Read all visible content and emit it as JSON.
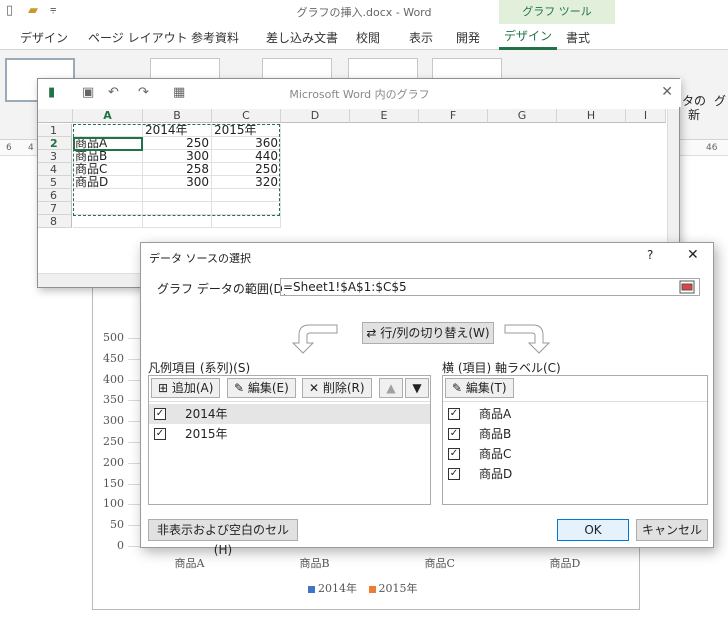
{
  "word": {
    "doc_title": "グラフの挿入.docx - Word",
    "tool_context": "グラフ ツール",
    "tabs": [
      "デザイン",
      "ページ レイアウト",
      "参考資料",
      "差し込み文書",
      "校閲",
      "表示",
      "開発",
      "デザイン",
      "書式"
    ],
    "ribbon_right_labels": [
      "タの",
      "新",
      "グ"
    ],
    "ruler_marks": [
      "6",
      "4",
      "46"
    ]
  },
  "excel": {
    "caption": "Microsoft Word 内のグラフ",
    "columns": [
      "A",
      "B",
      "C",
      "D",
      "E",
      "F",
      "G",
      "H",
      "I"
    ],
    "rows": [
      {
        "n": "1",
        "A": "",
        "B": "2014年",
        "C": "2015年"
      },
      {
        "n": "2",
        "A": "商品A",
        "B": "250",
        "C": "360"
      },
      {
        "n": "3",
        "A": "商品B",
        "B": "300",
        "C": "440"
      },
      {
        "n": "4",
        "A": "商品C",
        "B": "258",
        "C": "250"
      },
      {
        "n": "5",
        "A": "商品D",
        "B": "300",
        "C": "320"
      },
      {
        "n": "6",
        "A": "",
        "B": "",
        "C": ""
      },
      {
        "n": "7",
        "A": "",
        "B": "",
        "C": ""
      },
      {
        "n": "8",
        "A": "",
        "B": "",
        "C": ""
      }
    ]
  },
  "dialog": {
    "title": "データ ソースの選択",
    "help": "?",
    "close": "✕",
    "range_label": "グラフ データの範囲(D):",
    "range_value": "=Sheet1!$A$1:$C$5",
    "switch_label": "行/列の切り替え(W)",
    "series_pane_label": "凡例項目 (系列)(S)",
    "series_add": "追加(A)",
    "series_edit": "編集(E)",
    "series_delete": "削除(R)",
    "series": [
      {
        "label": "2014年",
        "checked": true,
        "selected": true
      },
      {
        "label": "2015年",
        "checked": true,
        "selected": false
      }
    ],
    "axis_pane_label": "横 (項目) 軸ラベル(C)",
    "axis_edit": "編集(T)",
    "axis_items": [
      {
        "label": "商品A",
        "checked": true
      },
      {
        "label": "商品B",
        "checked": true
      },
      {
        "label": "商品C",
        "checked": true
      },
      {
        "label": "商品D",
        "checked": true
      }
    ],
    "hidden_cells": "非表示および空白のセル(H)",
    "ok": "OK",
    "cancel": "キャンセル"
  },
  "chart_data": {
    "type": "bar",
    "categories": [
      "商品A",
      "商品B",
      "商品C",
      "商品D"
    ],
    "series": [
      {
        "name": "2014年",
        "values": [
          250,
          300,
          258,
          300
        ],
        "color": "#4472c4"
      },
      {
        "name": "2015年",
        "values": [
          360,
          440,
          250,
          320
        ],
        "color": "#ed7d31"
      }
    ],
    "yticks": [
      "500",
      "450",
      "400",
      "350",
      "300",
      "250",
      "200",
      "150",
      "100",
      "50",
      "0"
    ],
    "ylim": [
      0,
      500
    ],
    "legend_position": "bottom"
  }
}
